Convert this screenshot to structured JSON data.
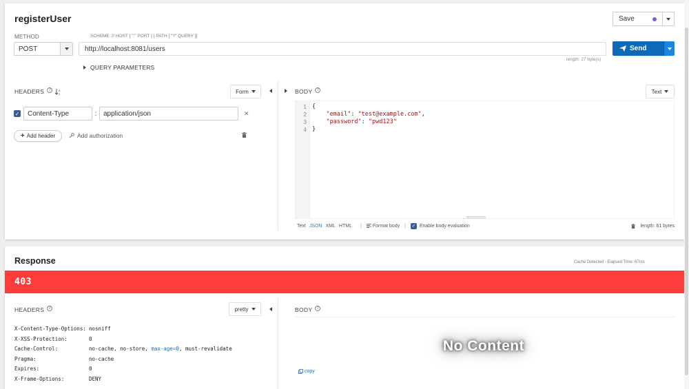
{
  "request": {
    "title": "registerUser",
    "save_label": "Save",
    "method_label": "METHOD",
    "scheme_label": "SCHEME :// HOST [ \":\" PORT ] [ PATH [ \"?\" QUERY ]]",
    "method": "POST",
    "url": "http://localhost:8081/users",
    "url_length": "length: 27 byte(s)",
    "send_label": "Send",
    "query_params_label": "QUERY PARAMETERS",
    "headers": {
      "title": "HEADERS",
      "mode": "Form",
      "rows": [
        {
          "name": "Content-Type",
          "value": "application/json",
          "checked": true
        }
      ],
      "add_header_label": "Add header",
      "add_auth_label": "Add authorization"
    },
    "body": {
      "title": "BODY",
      "mode": "Text",
      "lines": [
        "1",
        "2",
        "3",
        "4"
      ],
      "code": {
        "open": "{",
        "email_key": "\"email\"",
        "email_value": "\"test@example.com\"",
        "password_key": "\"password\"",
        "password_value": "\"pwd123\"",
        "close": "}"
      },
      "formats": [
        "Text",
        "JSON",
        "XML",
        "HTML"
      ],
      "active_format": "JSON",
      "format_body_label": "Format body",
      "eval_label": "Enable body evaluation",
      "length": "length: 61 bytes"
    }
  },
  "response": {
    "title": "Response",
    "timing": "Cache Detected - Elapsed Time: 67ms",
    "status_code": "403",
    "status_color": "#fe3c3c",
    "headers_title": "HEADERS",
    "headers_mode": "pretty",
    "body_title": "BODY",
    "headers": [
      {
        "name": "X-Content-Type-Options:",
        "value": "nosniff"
      },
      {
        "name": "X-XSS-Protection:",
        "value": "0"
      },
      {
        "name": "Cache-Control:",
        "value_parts": [
          "no-cache, no-store, ",
          "max-age=0",
          ", must-revalidate"
        ]
      },
      {
        "name": "Pragma:",
        "value": "no-cache"
      },
      {
        "name": "Expires:",
        "value": "0"
      },
      {
        "name": "X-Frame-Options:",
        "value": "DENY"
      }
    ],
    "no_content_label": "No Content",
    "copy_label": "copy"
  },
  "colors": {
    "accent": "#0e6ab8",
    "accent_light": "#1b86e0",
    "checkbox": "#3c5e8e",
    "save_dot": "#6b66d8",
    "error": "#fe3c3c"
  }
}
